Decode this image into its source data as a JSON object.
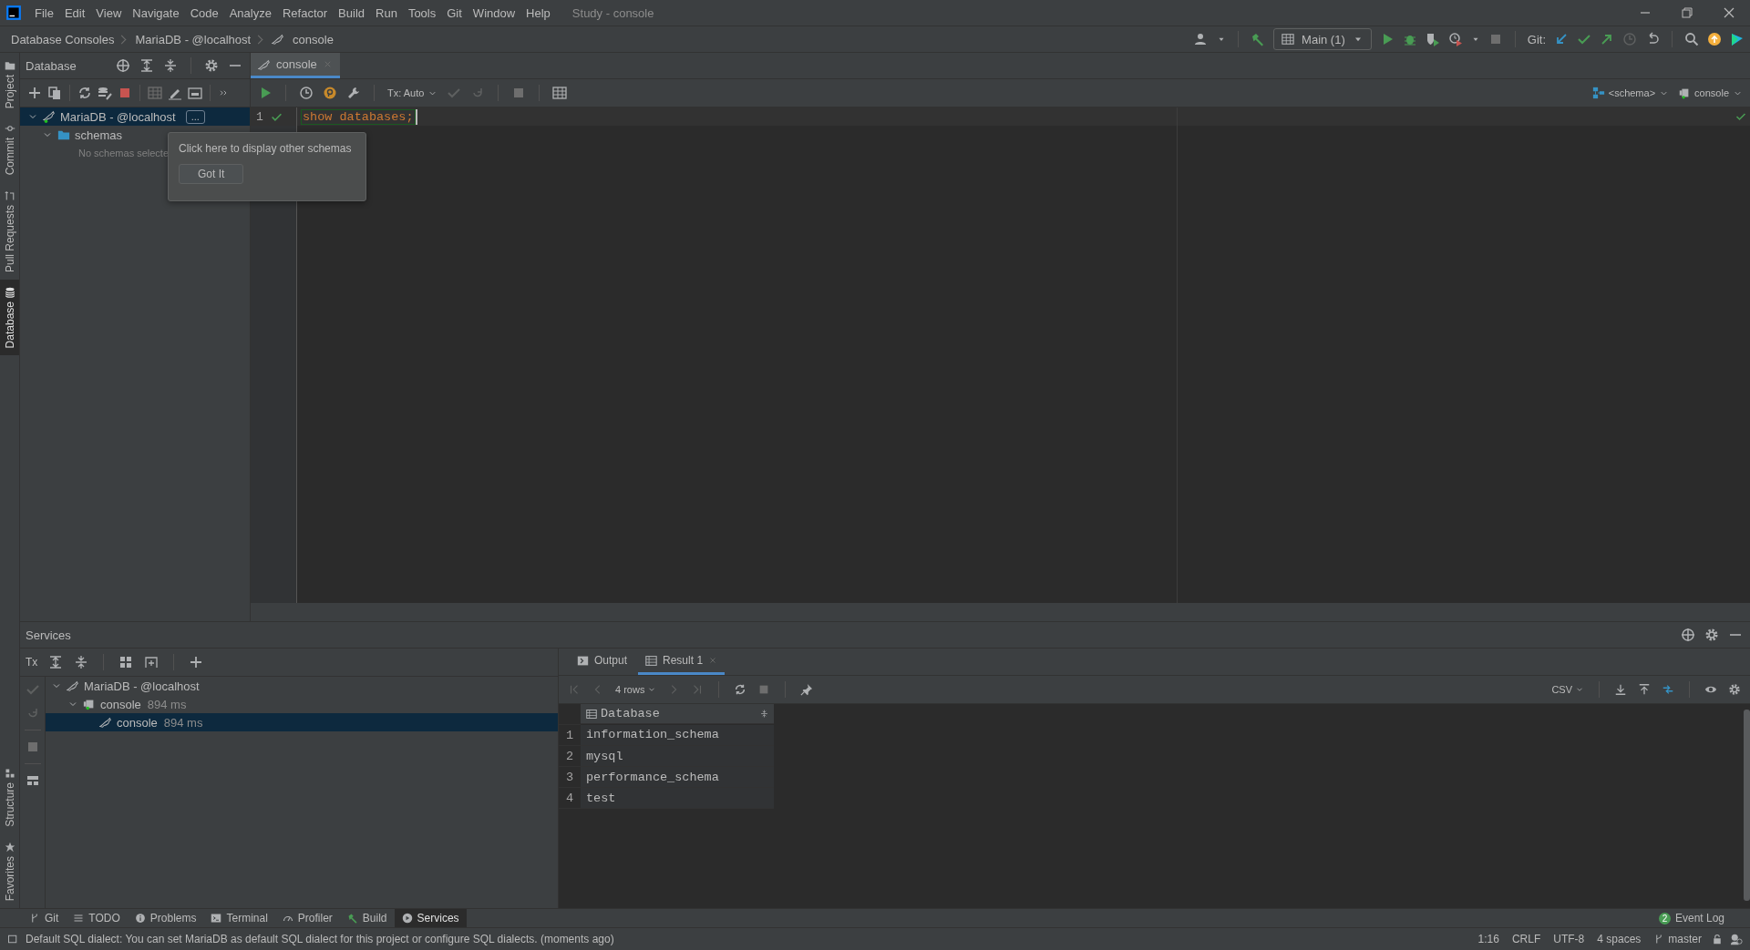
{
  "title_bar": {
    "menu": [
      "File",
      "Edit",
      "View",
      "Navigate",
      "Code",
      "Analyze",
      "Refactor",
      "Build",
      "Run",
      "Tools",
      "Git",
      "Window",
      "Help"
    ],
    "title": "Study - console"
  },
  "nav_bar": {
    "breadcrumbs": [
      "Database Consoles",
      "MariaDB - @localhost",
      "console"
    ],
    "run_config": "Main (1)",
    "git_label": "Git:"
  },
  "left_stripe": {
    "top": [
      {
        "label": "Project",
        "selected": false
      },
      {
        "label": "Commit",
        "selected": false
      },
      {
        "label": "Pull Requests",
        "selected": false
      },
      {
        "label": "Database",
        "selected": true
      }
    ],
    "bottom": [
      {
        "label": "Structure",
        "selected": false
      },
      {
        "label": "Favorites",
        "selected": false
      }
    ]
  },
  "database_panel": {
    "title": "Database",
    "tree": [
      {
        "label": "MariaDB - @localhost",
        "badge": "...",
        "selected": true,
        "expanded": true,
        "children": [
          {
            "label": "schemas",
            "selected": false,
            "expanded": true,
            "children": [
              {
                "label": "No schemas selecte",
                "kind": "hint"
              }
            ]
          }
        ]
      }
    ]
  },
  "tooltip": {
    "text": "Click here to display other schemas",
    "button": "Got It"
  },
  "editor": {
    "tab": "console",
    "tx_mode": "Tx: Auto",
    "schema": "<schema>",
    "session": "console",
    "lines": [
      {
        "number": "1",
        "code": "show databases;"
      }
    ]
  },
  "services": {
    "title": "Services",
    "tx": "Tx",
    "tree": [
      {
        "label": "MariaDB - @localhost",
        "selected": false,
        "expanded": true,
        "children": [
          {
            "label": "console",
            "detail": "894 ms",
            "selected": false,
            "expanded": true,
            "children": [
              {
                "label": "console",
                "detail": "894 ms",
                "selected": true
              }
            ]
          }
        ]
      }
    ],
    "result_tabs": [
      {
        "label": "Output",
        "selected": false
      },
      {
        "label": "Result 1",
        "selected": true
      }
    ],
    "rows_label": "4 rows",
    "export_format": "CSV",
    "table": {
      "columns": [
        "Database"
      ],
      "rows": [
        {
          "number": "1",
          "cells": [
            "information_schema"
          ]
        },
        {
          "number": "2",
          "cells": [
            "mysql"
          ]
        },
        {
          "number": "3",
          "cells": [
            "performance_schema"
          ]
        },
        {
          "number": "4",
          "cells": [
            "test"
          ]
        }
      ]
    }
  },
  "tool_bar": {
    "items": [
      {
        "label": "Git",
        "selected": false
      },
      {
        "label": "TODO",
        "selected": false
      },
      {
        "label": "Problems",
        "selected": false
      },
      {
        "label": "Terminal",
        "selected": false
      },
      {
        "label": "Profiler",
        "selected": false
      },
      {
        "label": "Build",
        "selected": false
      },
      {
        "label": "Services",
        "selected": true
      }
    ],
    "event_count": "2",
    "event_log": "Event Log"
  },
  "status_bar": {
    "message": "Default SQL dialect: You can set MariaDB as default SQL dialect for this project or configure SQL dialects. (moments ago)",
    "items": [
      "1:16",
      "CRLF",
      "UTF-8",
      "4 spaces"
    ],
    "branch": "master"
  }
}
